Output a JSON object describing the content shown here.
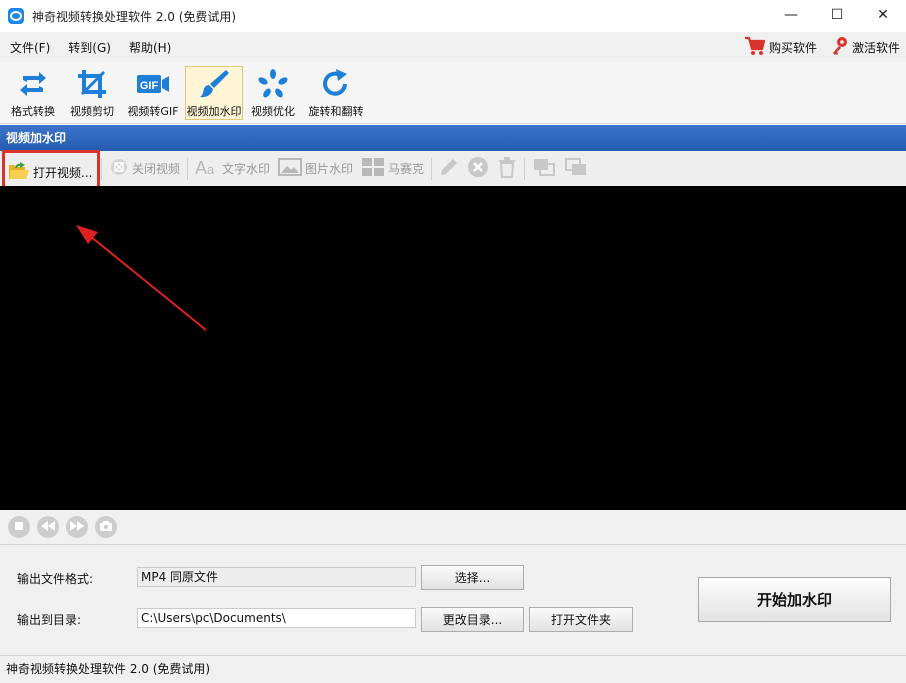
{
  "window": {
    "title": "神奇视频转换处理软件 2.0 (免费试用)",
    "minimize": "—",
    "maximize": "☐",
    "close": "✕"
  },
  "menu": {
    "items": [
      "文件(F)",
      "转到(G)",
      "帮助(H)"
    ],
    "buy_label": "购买软件",
    "activate_label": "激活软件"
  },
  "toolbar": {
    "items": [
      {
        "label": "格式转换",
        "icon": "format-convert-icon"
      },
      {
        "label": "视频剪切",
        "icon": "crop-icon"
      },
      {
        "label": "视频转GIF",
        "icon": "gif-icon"
      },
      {
        "label": "视频加水印",
        "icon": "brush-icon",
        "active": true
      },
      {
        "label": "视频优化",
        "icon": "optimize-icon"
      },
      {
        "label": "旋转和翻转",
        "icon": "rotate-icon"
      }
    ]
  },
  "section": {
    "title": "视频加水印"
  },
  "subtoolbar": {
    "open_video": "打开视频...",
    "close_video": "关闭视频",
    "text_watermark": "文字水印",
    "image_watermark": "图片水印",
    "mosaic": "马赛克"
  },
  "output": {
    "format_label": "输出文件格式:",
    "format_value": "MP4 同原文件",
    "select_button": "选择...",
    "dir_label": "输出到目录:",
    "dir_value": "C:\\Users\\pc\\Documents\\",
    "change_dir_button": "更改目录...",
    "open_folder_button": "打开文件夹",
    "start_button": "开始加水印"
  },
  "statusbar": {
    "text": "神奇视频转换处理软件 2.0 (免费试用)"
  },
  "colors": {
    "accent_blue": "#2a62b8",
    "highlight_red": "#d9342b",
    "icon_blue": "#1e7fd8"
  }
}
